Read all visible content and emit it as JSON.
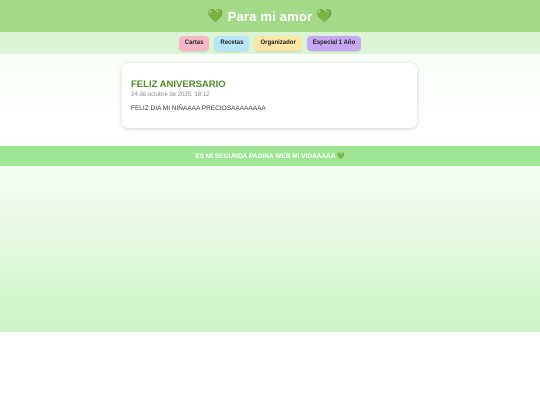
{
  "header": {
    "title": "Para mi amor",
    "heart_left": "💚",
    "heart_right": "💚"
  },
  "nav": {
    "items": [
      {
        "label": "Cartas",
        "color": "#f6b8c6"
      },
      {
        "label": "Recetas",
        "color": "#b6e6f8"
      },
      {
        "label": "Organizador",
        "color": "#fbe7a5"
      },
      {
        "label": "Especial 1 Año",
        "color": "#c7a7f1"
      }
    ]
  },
  "card": {
    "title": "FELIZ ANIVERSARIO",
    "date": "24 de octubre de 2025, 18:12",
    "body": "FELIZ DIA MI NIÑAAAA PRECIOSAAAAAAAA"
  },
  "footer": {
    "text": "ES MI SEGUNDA PAGINA WEB MI VIDAAAAA",
    "heart": "💚"
  },
  "colors": {
    "header_bg": "#a5d98a",
    "nav_bg": "#dcf3d6",
    "footer_bg": "#9ee596",
    "title_green": "#4f8a2b"
  }
}
